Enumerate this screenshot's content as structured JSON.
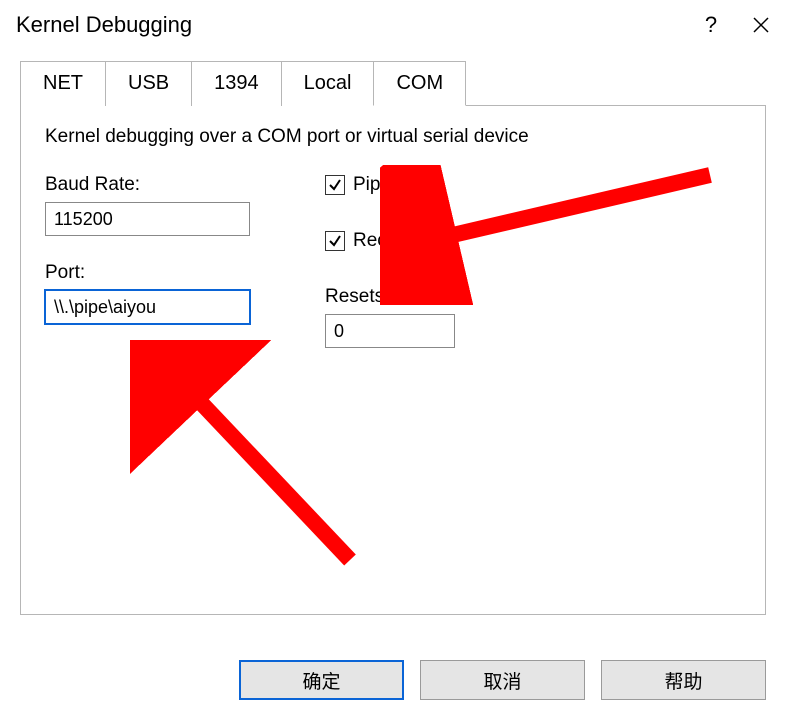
{
  "window": {
    "title": "Kernel Debugging"
  },
  "tabs": {
    "net": "NET",
    "usb": "USB",
    "t1394": "1394",
    "local": "Local",
    "com": "COM"
  },
  "panel": {
    "description": "Kernel debugging over a COM port or virtual serial device",
    "baud_rate_label": "Baud Rate:",
    "baud_rate_value": "115200",
    "port_label": "Port:",
    "port_value": "\\\\.\\pipe\\aiyou",
    "pipe_label": "Pipe",
    "reconnect_label": "Reconnect",
    "resets_label": "Resets:",
    "resets_value": "0"
  },
  "buttons": {
    "ok": "确定",
    "cancel": "取消",
    "help": "帮助"
  },
  "colors": {
    "accent": "#0a64d6",
    "annotation": "#ff0000"
  }
}
